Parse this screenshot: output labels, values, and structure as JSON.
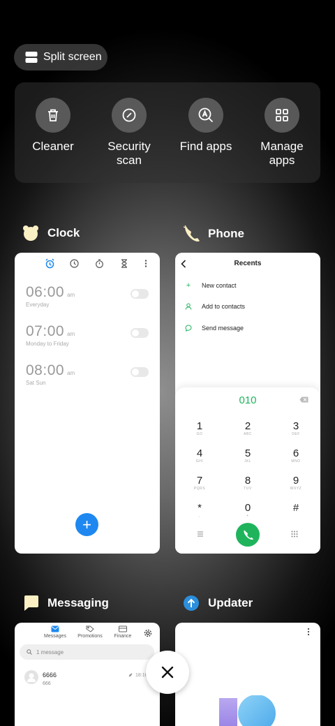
{
  "split_screen": {
    "label": "Split screen",
    "icon": "split-screen-icon"
  },
  "tools": [
    {
      "label": "Cleaner",
      "icon": "trash-icon"
    },
    {
      "label": "Security scan",
      "label_lines": [
        "Security",
        "scan"
      ],
      "icon": "security-scan-icon"
    },
    {
      "label": "Find apps",
      "icon": "find-apps-icon"
    },
    {
      "label": "Manage apps",
      "label_lines": [
        "Manage",
        "apps"
      ],
      "icon": "grid-icon"
    }
  ],
  "apps": {
    "clock": {
      "name": "Clock",
      "alarms": [
        {
          "time": "06:00",
          "ampm": "am",
          "repeat": "Everyday",
          "enabled": false
        },
        {
          "time": "07:00",
          "ampm": "am",
          "repeat": "Monday to Friday",
          "enabled": false
        },
        {
          "time": "08:00",
          "ampm": "am",
          "repeat": "Sat Sun",
          "enabled": false
        }
      ],
      "fab": "+"
    },
    "phone": {
      "name": "Phone",
      "title": "Recents",
      "actions": [
        {
          "label": "New contact",
          "icon": "plus-icon"
        },
        {
          "label": "Add to contacts",
          "icon": "person-icon"
        },
        {
          "label": "Send message",
          "icon": "message-icon"
        }
      ],
      "dialed": "010",
      "keys": [
        {
          "digit": "1",
          "letters": "GO"
        },
        {
          "digit": "2",
          "letters": "ABC"
        },
        {
          "digit": "3",
          "letters": "DEF"
        },
        {
          "digit": "4",
          "letters": "GHI"
        },
        {
          "digit": "5",
          "letters": "JKL"
        },
        {
          "digit": "6",
          "letters": "MNO"
        },
        {
          "digit": "7",
          "letters": "PQRS"
        },
        {
          "digit": "8",
          "letters": "TUV"
        },
        {
          "digit": "9",
          "letters": "WXYZ"
        },
        {
          "digit": "*",
          "letters": ","
        },
        {
          "digit": "0",
          "letters": "+"
        },
        {
          "digit": "#",
          "letters": ""
        }
      ]
    },
    "messaging": {
      "name": "Messaging",
      "tabs": [
        "Messages",
        "Promotions",
        "Finance"
      ],
      "search_placeholder": "1 message",
      "thread": {
        "sender": "6666",
        "preview": "666",
        "time": "18:16"
      }
    },
    "updater": {
      "name": "Updater"
    }
  },
  "colors": {
    "accent_blue": "#1e88f0",
    "phone_green": "#1fb45c"
  }
}
